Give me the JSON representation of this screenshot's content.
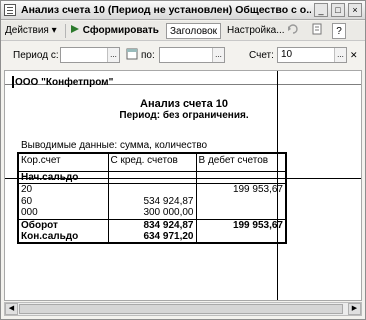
{
  "window": {
    "title": "Анализ счета 10 (Период не установлен) Общество с о...",
    "minimize": "_",
    "maximize": "□",
    "close": "×"
  },
  "toolbar": {
    "actions_label": "Действия",
    "actions_arrow": "▾",
    "generate_label": "Сформировать",
    "header_label": "Заголовок",
    "settings_label": "Настройка...",
    "help_label": "?"
  },
  "params": {
    "period_from_label": "Период с:",
    "period_from_value": "",
    "period_to_label": "по:",
    "period_to_value": "",
    "account_label": "Счет:",
    "account_value": "10",
    "ellipsis": "..."
  },
  "report": {
    "company": "ООО \"Конфетпром\"",
    "title": "Анализ счета 10",
    "period": "Период: без ограничения.",
    "output_data": "Выводимые данные: сумма, количество",
    "columns": [
      "Кор.счет",
      "С кред. счетов",
      "В дебет счетов"
    ],
    "opening_label": "Нач.сальдо",
    "rows": [
      {
        "account": "20",
        "credit": "",
        "debit": "199 953,67"
      },
      {
        "account": "60",
        "credit": "534 924,87",
        "debit": ""
      },
      {
        "account": "000",
        "credit": "300 000,00",
        "debit": ""
      }
    ],
    "turnover_label": "Оборот",
    "turnover_credit": "834 924,87",
    "turnover_debit": "199 953,67",
    "closing_label": "Кон.сальдо",
    "closing_credit": "634 971,20",
    "closing_debit": ""
  }
}
